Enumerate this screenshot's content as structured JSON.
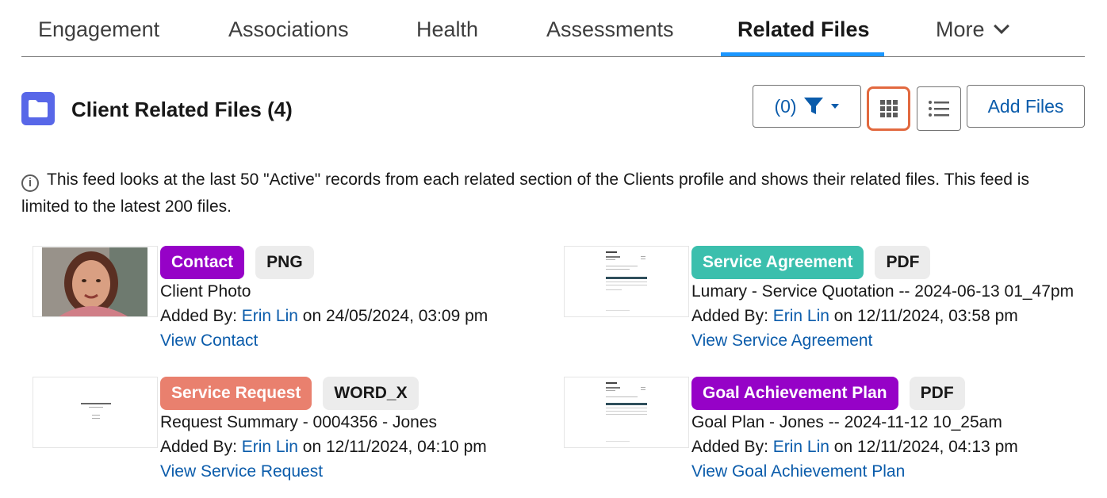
{
  "tabs": [
    {
      "label": "Engagement"
    },
    {
      "label": "Associations"
    },
    {
      "label": "Health"
    },
    {
      "label": "Assessments"
    },
    {
      "label": "Related Files",
      "active": true
    },
    {
      "label": "More"
    }
  ],
  "header": {
    "title": "Client Related Files (4)",
    "filter_label": "(0)",
    "add_files_label": "Add Files"
  },
  "info": {
    "text": "This feed looks at the last 50 \"Active\" records from each related section of the Clients profile and shows their related files. This feed is limited to the latest 200 files."
  },
  "files": [
    {
      "category": "Contact",
      "category_color": "#9602c7",
      "file_type": "PNG",
      "name": "Client Photo",
      "added_prefix": "Added By: ",
      "added_by": "Erin Lin",
      "added_on": " on 24/05/2024, 03:09 pm",
      "view_link": "View Contact",
      "thumb": "photo"
    },
    {
      "category": "Service Agreement",
      "category_color": "#3bbfad",
      "file_type": "PDF",
      "name": "Lumary - Service Quotation -- 2024-06-13 01_47pm",
      "added_prefix": "Added By: ",
      "added_by": "Erin Lin",
      "added_on": " on 12/11/2024, 03:58 pm",
      "view_link": "View Service Agreement",
      "thumb": "pdf"
    },
    {
      "category": "Service Request",
      "category_color": "#e9806e",
      "file_type": "WORD_X",
      "name": "Request Summary - 0004356 - Jones",
      "added_prefix": "Added By: ",
      "added_by": "Erin Lin",
      "added_on": " on 12/11/2024, 04:10 pm",
      "view_link": "View Service Request",
      "thumb": "doc"
    },
    {
      "category": "Goal Achievement Plan",
      "category_color": "#9602c7",
      "file_type": "PDF",
      "name": "Goal Plan - Jones -- 2024-11-12 10_25am",
      "added_prefix": "Added By: ",
      "added_by": "Erin Lin",
      "added_on": " on 12/11/2024, 04:13 pm",
      "view_link": "View Goal Achievement Plan",
      "thumb": "pdf"
    }
  ],
  "icons": {
    "folder": "folder-icon",
    "filter": "filter-icon",
    "grid": "grid-view-icon",
    "list": "list-view-icon",
    "info": "info-icon"
  },
  "colors": {
    "accent": "#0b5cab",
    "tab_underline": "#1b96ff",
    "grid_focus": "#e2693f",
    "folder": "#5867e8"
  }
}
